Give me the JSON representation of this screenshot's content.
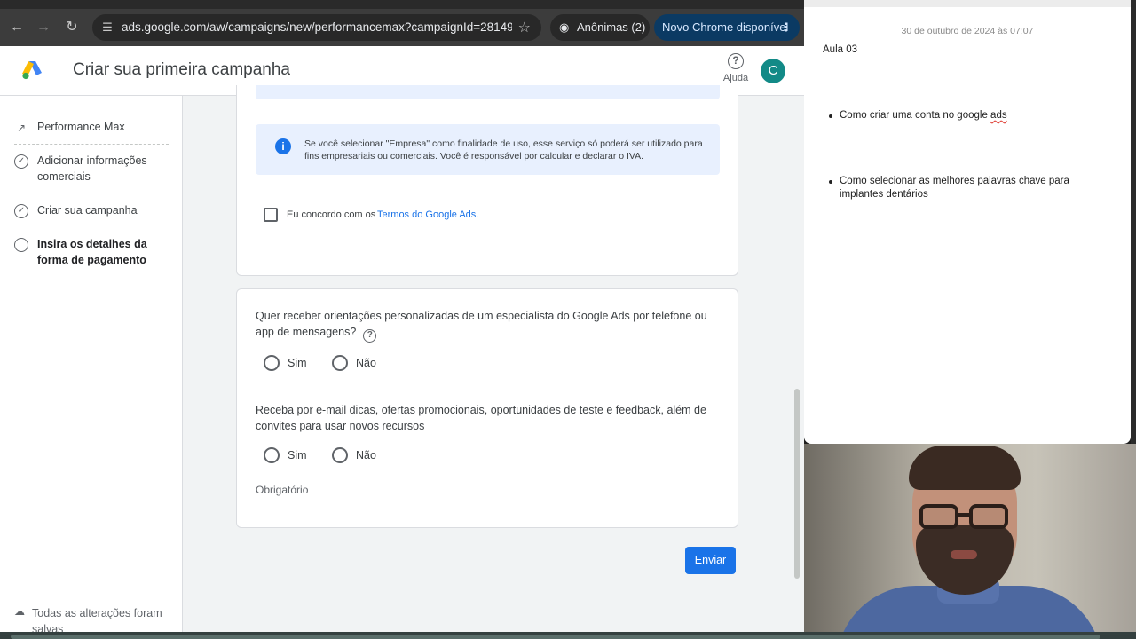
{
  "browser": {
    "url": "ads.google.com/aw/campaigns/new/performancemax?campaignId=28149...",
    "incognito_label": "Anônimas (2)",
    "update_label": "Novo Chrome disponível"
  },
  "header": {
    "title": "Criar sua primeira campanha",
    "help_label": "Ajuda",
    "avatar_letter": "C"
  },
  "sidebar": {
    "steps": [
      {
        "label": "Performance Max"
      },
      {
        "label": "Adicionar informações comerciais"
      },
      {
        "label": "Criar sua campanha"
      },
      {
        "label": "Insira os detalhes da forma de pagamento"
      }
    ],
    "saved_label": "Todas as alterações foram salvas"
  },
  "main": {
    "info_text": "Se você selecionar \"Empresa\" como finalidade de uso, esse serviço só poderá ser utilizado para fins empresariais ou comerciais. Você é responsável por calcular e declarar o IVA.",
    "terms_prefix": "Eu concordo com os",
    "terms_link": "Termos do Google Ads.",
    "question_1": "Quer receber orientações personalizadas de um especialista do Google Ads por telefone ou app de mensagens?",
    "question_2": "Receba por e-mail dicas, ofertas promocionais, oportunidades de teste e feedback, além de convites para usar novos recursos",
    "option_yes": "Sim",
    "option_no": "Não",
    "required_label": "Obrigatório",
    "submit_label": "Enviar"
  },
  "notes": {
    "date": "30 de outubro de 2024 às 07:07",
    "title": "Aula 03",
    "bullet_1_text": "Como criar uma conta no google ",
    "bullet_1_misspelled": "ads",
    "bullet_2": "Como selecionar as melhores palavras chave para implantes dentários"
  },
  "colors": {
    "accent": "#1a73e8",
    "info_bg": "#e8f0fe",
    "avatar": "#128a87"
  }
}
